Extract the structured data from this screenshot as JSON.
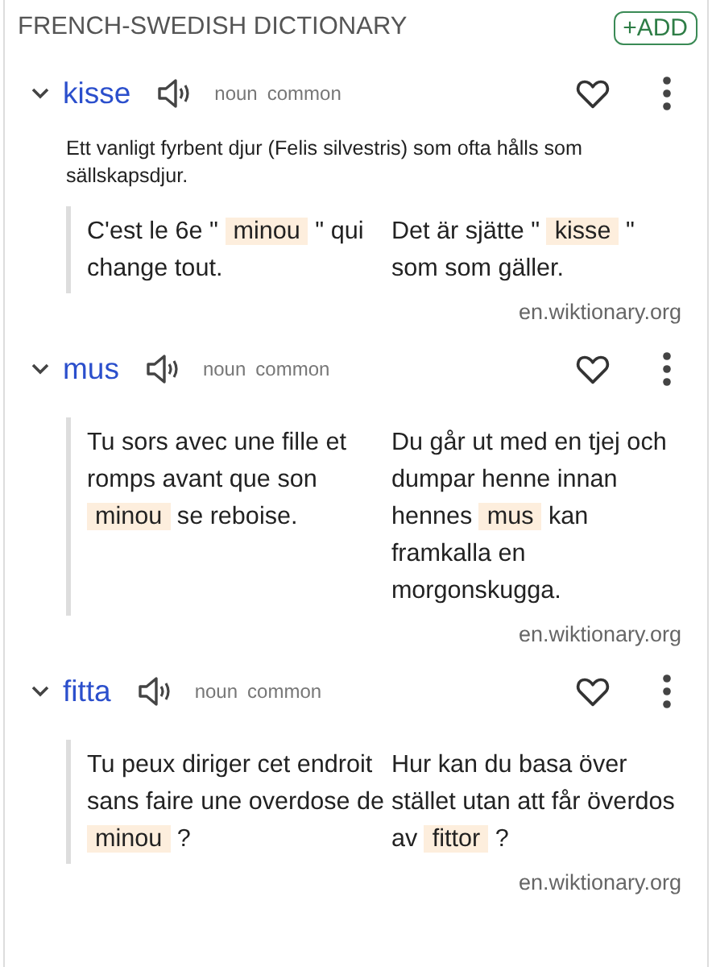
{
  "header": {
    "title": "FRENCH-SWEDISH DICTIONARY",
    "add_button": "+ADD"
  },
  "entries": [
    {
      "word": "kisse",
      "tags": [
        "noun",
        "common"
      ],
      "definition": "Ett vanligt fyrbent djur (Felis silvestris) som ofta hålls som sällskapsdjur.",
      "source": "en.wiktionary.org",
      "french": [
        {
          "text": "C'est le 6e \"",
          "highlight": false
        },
        {
          "text": "minou",
          "highlight": true
        },
        {
          "text": "\" qui change tout.",
          "highlight": false
        }
      ],
      "swedish": [
        {
          "text": "Det är sjätte \"",
          "highlight": false
        },
        {
          "text": "kisse",
          "highlight": true
        },
        {
          "text": "\" som som gäller.",
          "highlight": false
        }
      ]
    },
    {
      "word": "mus",
      "tags": [
        "noun",
        "common"
      ],
      "source": "en.wiktionary.org",
      "french": [
        {
          "text": "Tu sors avec une fille et romps avant que son",
          "highlight": false
        },
        {
          "text": "minou",
          "highlight": true
        },
        {
          "text": "se reboise.",
          "highlight": false
        }
      ],
      "swedish": [
        {
          "text": "Du går ut med en tjej och dumpar henne innan hennes",
          "highlight": false
        },
        {
          "text": "mus",
          "highlight": true
        },
        {
          "text": "kan framkalla en morgonskugga.",
          "highlight": false
        }
      ]
    },
    {
      "word": "fitta",
      "tags": [
        "noun",
        "common"
      ],
      "source": "en.wiktionary.org",
      "french": [
        {
          "text": "Tu peux diriger cet endroit sans faire une overdose de",
          "highlight": false
        },
        {
          "text": "minou",
          "highlight": true
        },
        {
          "text": "?",
          "highlight": false
        }
      ],
      "swedish": [
        {
          "text": "Hur kan du basa över stället utan att får överdos av",
          "highlight": false
        },
        {
          "text": "fittor",
          "highlight": true
        },
        {
          "text": "?",
          "highlight": false
        }
      ]
    }
  ]
}
